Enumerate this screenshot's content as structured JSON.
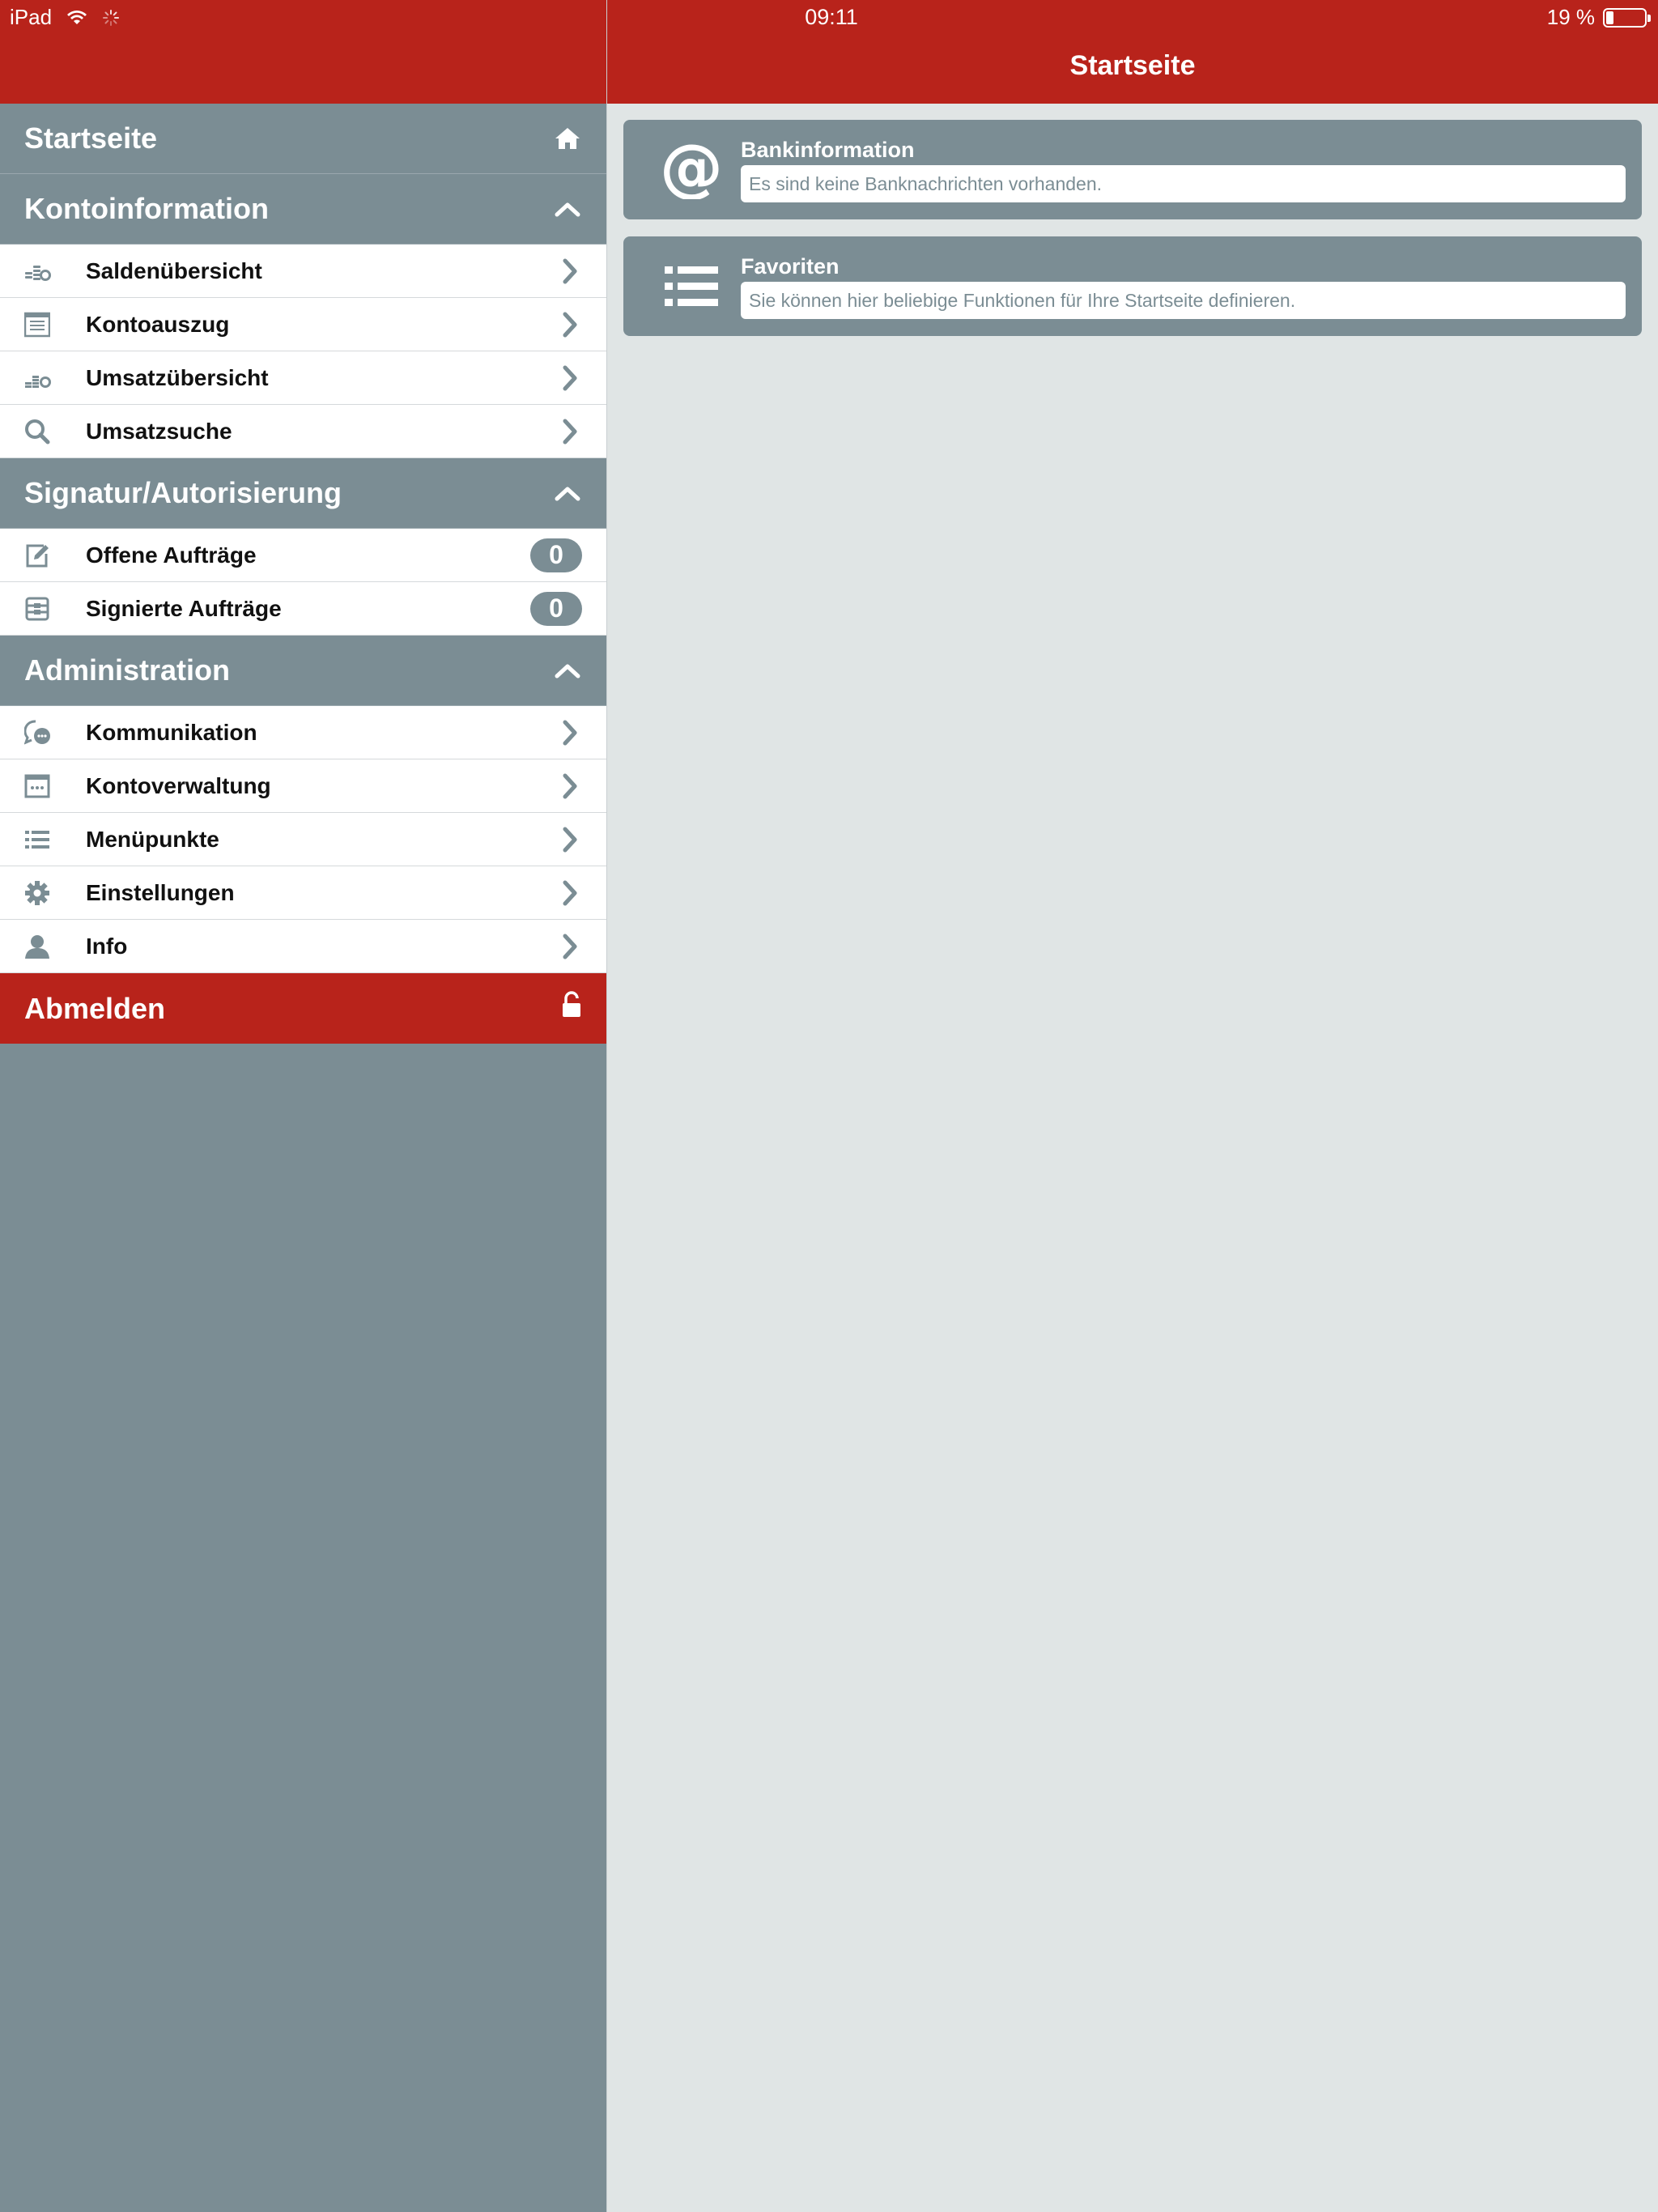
{
  "status": {
    "device": "iPad",
    "time": "09:11",
    "battery": "19 %",
    "battery_level": 0.19
  },
  "header": {
    "title": "Startseite"
  },
  "sidebar": {
    "home": {
      "label": "Startseite",
      "icon": "home-icon"
    },
    "sections": [
      {
        "title": "Kontoinformation",
        "items": [
          {
            "label": "Saldenübersicht",
            "icon": "coins-icon"
          },
          {
            "label": "Kontoauszug",
            "icon": "statement-icon"
          },
          {
            "label": "Umsatzübersicht",
            "icon": "transactions-icon"
          },
          {
            "label": "Umsatzsuche",
            "icon": "search-icon"
          }
        ]
      },
      {
        "title": "Signatur/Autorisierung",
        "items": [
          {
            "label": "Offene Aufträge",
            "icon": "edit-icon",
            "badge": "0"
          },
          {
            "label": "Signierte Aufträge",
            "icon": "inbox-icon",
            "badge": "0"
          }
        ]
      },
      {
        "title": "Administration",
        "items": [
          {
            "label": "Kommunikation",
            "icon": "chat-icon"
          },
          {
            "label": "Kontoverwaltung",
            "icon": "account-window-icon"
          },
          {
            "label": "Menüpunkte",
            "icon": "list-icon"
          },
          {
            "label": "Einstellungen",
            "icon": "gear-icon"
          },
          {
            "label": "Info",
            "icon": "person-icon"
          }
        ]
      }
    ],
    "logout": {
      "label": "Abmelden",
      "icon": "lock-icon"
    }
  },
  "main": {
    "cards": [
      {
        "title": "Bankinformation",
        "text": "Es sind keine Banknachrichten vorhanden.",
        "icon": "at-icon"
      },
      {
        "title": "Favoriten",
        "text": "Sie können hier beliebige Funktionen für Ihre Startseite definieren.",
        "icon": "list-icon"
      }
    ]
  },
  "colors": {
    "brand_red": "#b8231b",
    "slate": "#7b8d94",
    "content_bg": "#e0e5e5"
  }
}
